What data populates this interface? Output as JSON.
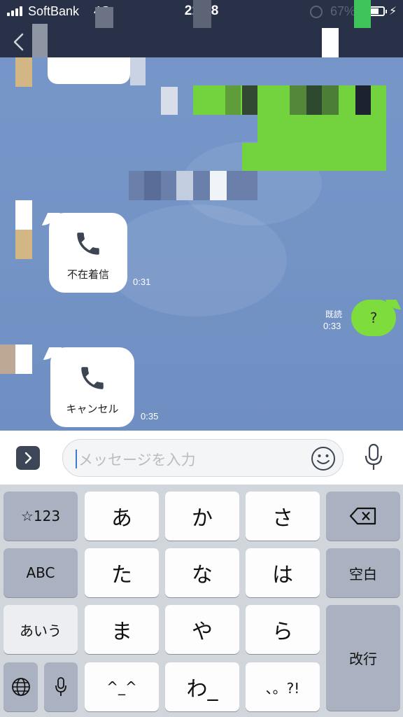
{
  "status_bar": {
    "carrier": "SoftBank",
    "network": "4G",
    "time": "21:38",
    "battery_percent": "67%"
  },
  "chat": {
    "messages": [
      {
        "type": "missed-call",
        "label": "不在着信",
        "time": "0:31"
      },
      {
        "type": "sent",
        "text": "?",
        "read": "既読",
        "time": "0:33"
      },
      {
        "type": "canceled-call",
        "label": "キャンセル",
        "time": "0:35"
      }
    ]
  },
  "input": {
    "placeholder": "メッセージを入力"
  },
  "keyboard": {
    "rows": [
      [
        "☆123",
        "あ",
        "か",
        "さ",
        "⌫"
      ],
      [
        "ABC",
        "た",
        "な",
        "は",
        "空白"
      ],
      [
        "あいう",
        "ま",
        "や",
        "ら",
        "改行"
      ],
      [
        "globe",
        "mic",
        "^_^",
        "わ_",
        "、。?!"
      ]
    ]
  },
  "icons": {
    "back": "chevron-left-icon",
    "expand": "chevron-right-icon",
    "phone": "phone-icon",
    "emoji": "smiley-icon",
    "mic": "microphone-icon",
    "globe": "globe-icon",
    "delete": "backspace-icon"
  },
  "colors": {
    "header": "#283147",
    "chat_background": "#7596c8",
    "sent_bubble": "#7edc3c",
    "keyboard": "#d1d5dc"
  }
}
